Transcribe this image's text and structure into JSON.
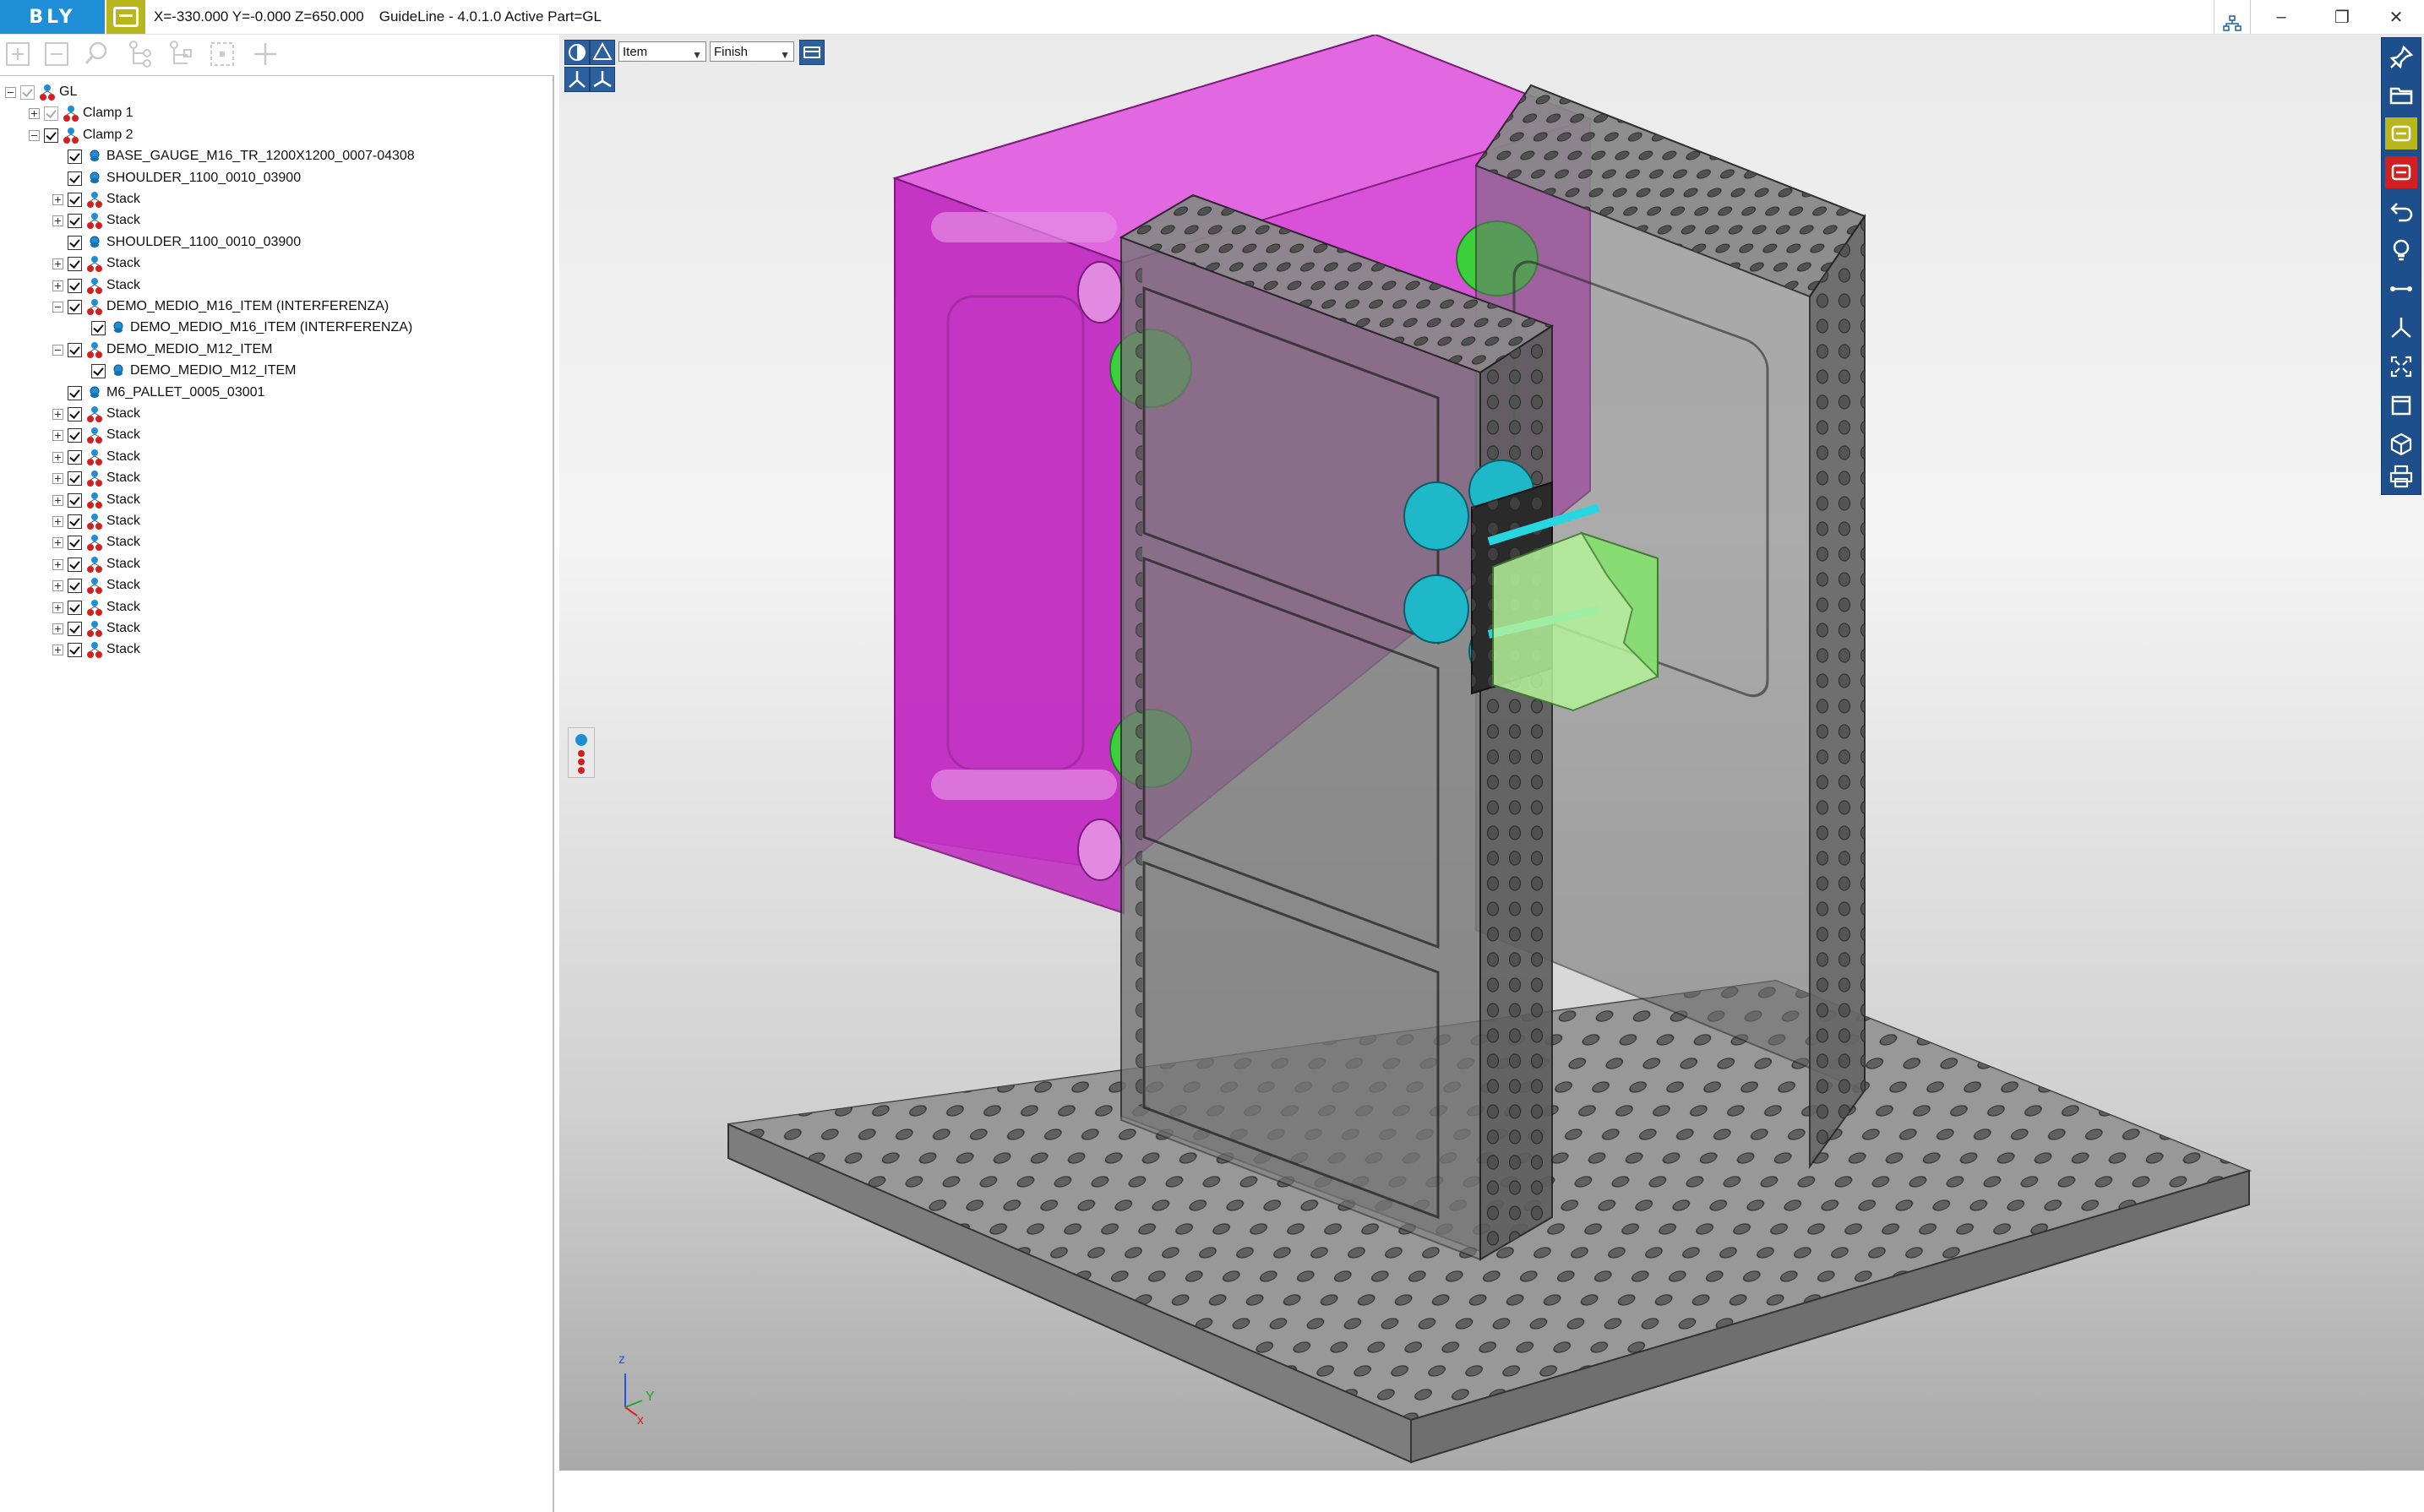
{
  "app": {
    "brand": "BLY",
    "status": "X=-330.000 Y=-0.000 Z=650.000",
    "title": "GuideLine - 4.0.1.0 Active Part=GL"
  },
  "window_controls": {
    "minimize": "–",
    "maximize": "❐",
    "close": "✕"
  },
  "tree": {
    "items": [
      {
        "label": "GL",
        "level": 0,
        "icon": "assembly",
        "expander": "minus",
        "checked": true,
        "grey": true
      },
      {
        "label": "Clamp 1",
        "level": 1,
        "icon": "assembly",
        "expander": "plus",
        "checked": true,
        "grey": true
      },
      {
        "label": "Clamp 2",
        "level": 1,
        "icon": "assembly",
        "expander": "minus",
        "checked": true,
        "grey": false
      },
      {
        "label": "BASE_GAUGE_M16_TR_1200X1200_0007-04308",
        "level": 2,
        "icon": "part",
        "expander": "",
        "checked": true
      },
      {
        "label": "SHOULDER_1100_0010_03900",
        "level": 2,
        "icon": "part",
        "expander": "",
        "checked": true
      },
      {
        "label": "Stack",
        "level": 2,
        "icon": "assembly",
        "expander": "plus",
        "checked": true
      },
      {
        "label": "Stack",
        "level": 2,
        "icon": "assembly",
        "expander": "plus",
        "checked": true
      },
      {
        "label": "SHOULDER_1100_0010_03900",
        "level": 2,
        "icon": "part",
        "expander": "",
        "checked": true
      },
      {
        "label": "Stack",
        "level": 2,
        "icon": "assembly",
        "expander": "plus",
        "checked": true
      },
      {
        "label": "Stack",
        "level": 2,
        "icon": "assembly",
        "expander": "plus",
        "checked": true
      },
      {
        "label": "DEMO_MEDIO_M16_ITEM (INTERFERENZA)",
        "level": 2,
        "icon": "assembly",
        "expander": "minus",
        "checked": true
      },
      {
        "label": "DEMO_MEDIO_M16_ITEM (INTERFERENZA)",
        "level": 3,
        "icon": "part",
        "expander": "",
        "checked": true
      },
      {
        "label": "DEMO_MEDIO_M12_ITEM",
        "level": 2,
        "icon": "assembly",
        "expander": "minus",
        "checked": true
      },
      {
        "label": "DEMO_MEDIO_M12_ITEM",
        "level": 3,
        "icon": "part",
        "expander": "",
        "checked": true
      },
      {
        "label": "M6_PALLET_0005_03001",
        "level": 2,
        "icon": "part",
        "expander": "",
        "checked": true
      },
      {
        "label": "Stack",
        "level": 2,
        "icon": "assembly",
        "expander": "plus",
        "checked": true
      },
      {
        "label": "Stack",
        "level": 2,
        "icon": "assembly",
        "expander": "plus",
        "checked": true
      },
      {
        "label": "Stack",
        "level": 2,
        "icon": "assembly",
        "expander": "plus",
        "checked": true
      },
      {
        "label": "Stack",
        "level": 2,
        "icon": "assembly",
        "expander": "plus",
        "checked": true
      },
      {
        "label": "Stack",
        "level": 2,
        "icon": "assembly",
        "expander": "plus",
        "checked": true
      },
      {
        "label": "Stack",
        "level": 2,
        "icon": "assembly",
        "expander": "plus",
        "checked": true
      },
      {
        "label": "Stack",
        "level": 2,
        "icon": "assembly",
        "expander": "plus",
        "checked": true
      },
      {
        "label": "Stack",
        "level": 2,
        "icon": "assembly",
        "expander": "plus",
        "checked": true
      },
      {
        "label": "Stack",
        "level": 2,
        "icon": "assembly",
        "expander": "plus",
        "checked": true
      },
      {
        "label": "Stack",
        "level": 2,
        "icon": "assembly",
        "expander": "plus",
        "checked": true
      },
      {
        "label": "Stack",
        "level": 2,
        "icon": "assembly",
        "expander": "plus",
        "checked": true
      },
      {
        "label": "Stack",
        "level": 2,
        "icon": "assembly",
        "expander": "plus",
        "checked": true
      }
    ]
  },
  "viewport": {
    "filter_select": "Item",
    "mode_select": "Finish",
    "axis": {
      "z": "z",
      "y": "Y",
      "x": "x"
    }
  },
  "colors": {
    "accent_blue": "#1e8fd6",
    "toolbar_blue": "#1d4f8c",
    "badge_yellow": "#b9b51c",
    "badge_red": "#d31f1f",
    "mold_magenta": "#d63cd6",
    "clamp_green": "#3ccf3c",
    "fixture_cyan": "#1fb8c8"
  }
}
